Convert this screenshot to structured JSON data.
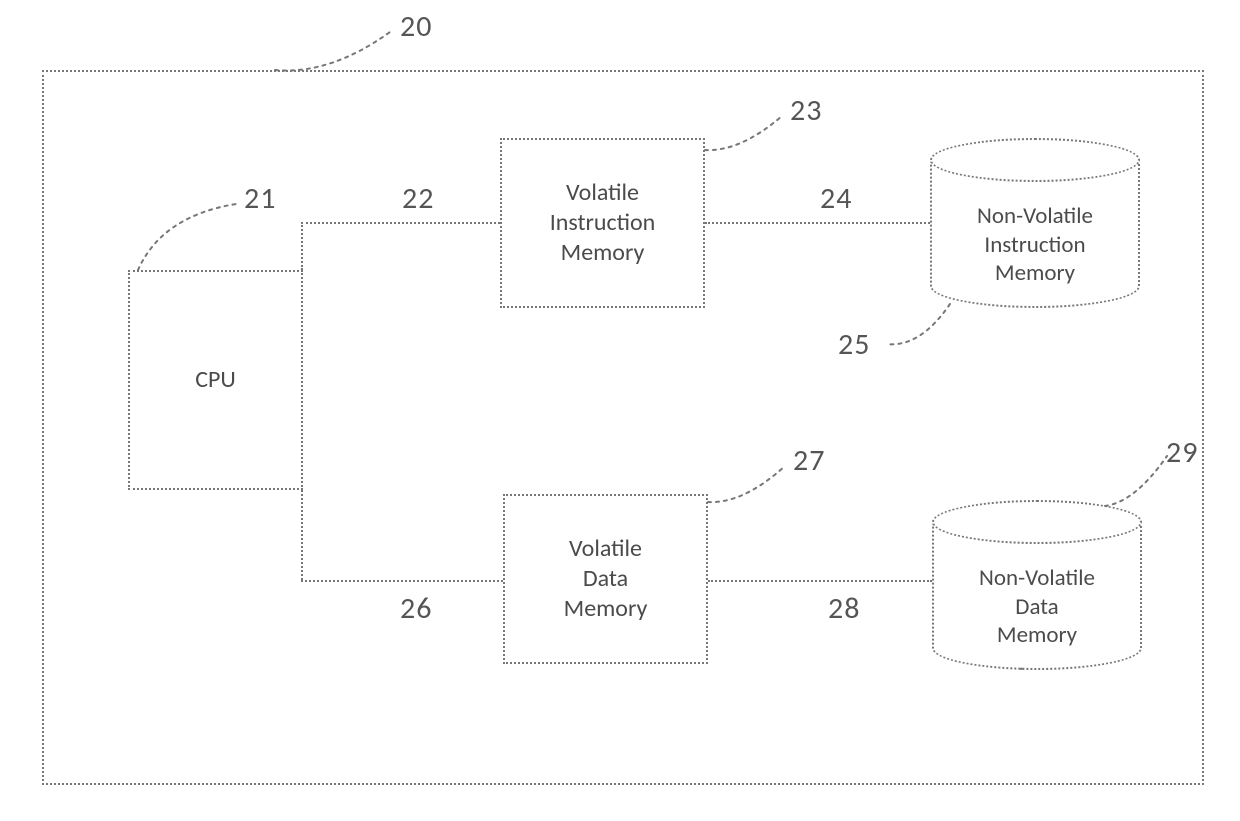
{
  "labels": {
    "system": "20",
    "cpu": "21",
    "bus_instr": "22",
    "vol_instr": "23",
    "bus_instr_nv": "24",
    "nv_instr": "25",
    "bus_data": "26",
    "vol_data": "27",
    "bus_data_nv": "28",
    "nv_data": "29"
  },
  "nodes": {
    "cpu": "CPU",
    "vol_instr": "Volatile\nInstruction\nMemory",
    "vol_data": "Volatile\nData\nMemory",
    "nv_instr": "Non-Volatile\nInstruction\nMemory",
    "nv_data": "Non-Volatile\nData\nMemory"
  }
}
